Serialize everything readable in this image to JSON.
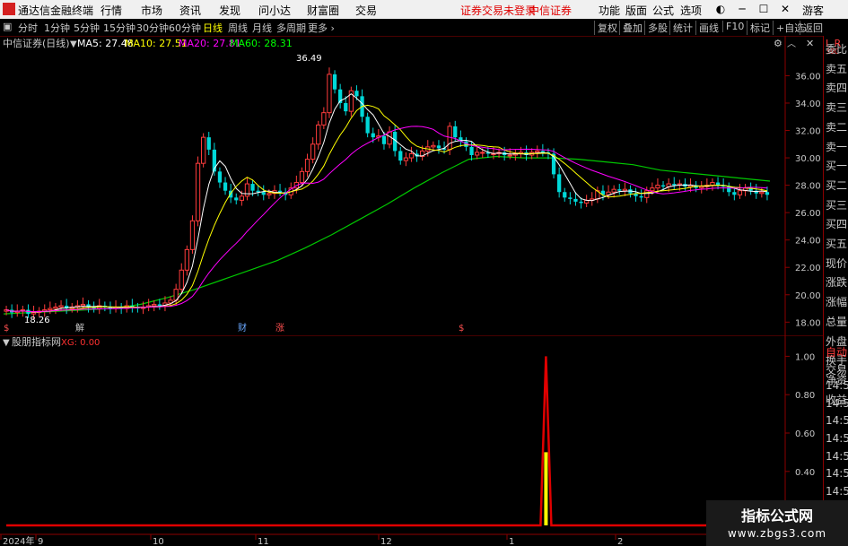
{
  "titlebar": {
    "app_name": "通达信金融终端",
    "menu": [
      "行情",
      "市场",
      "资讯",
      "发现",
      "问小达",
      "财富圈",
      "交易"
    ],
    "login_warning": "证券交易未登录",
    "broker": "中信证券",
    "right_menu": [
      "功能",
      "版面",
      "公式",
      "选项"
    ],
    "user": "游客"
  },
  "toolbar": {
    "periods": [
      "分时",
      "1分钟",
      "5分钟",
      "15分钟",
      "30分钟",
      "60分钟",
      "日线",
      "周线",
      "月线",
      "多周期",
      "更多"
    ],
    "selected_period": "日线",
    "right_buttons": [
      "复权",
      "叠加",
      "多股",
      "统计",
      "画线",
      "F10",
      "标记",
      "+自选",
      "返回"
    ]
  },
  "main_chart": {
    "stock_label": "中信证券(日线)",
    "ma_labels": [
      {
        "text": "MA5: 27.48",
        "color": "#ffffff"
      },
      {
        "text": "MA10: 27.51",
        "color": "#ffff00"
      },
      {
        "text": "MA20: 27.81",
        "color": "#ff00ff"
      },
      {
        "text": "MA60: 28.31",
        "color": "#00ff00"
      }
    ],
    "high_label": "36.49",
    "low_label": "18.26",
    "event_markers": [
      "解",
      "财",
      "涨"
    ]
  },
  "indicator": {
    "name": "股朋指标网",
    "value_label": "XG: 0.00"
  },
  "x_axis_labels": [
    "2024年",
    "9",
    "10",
    "11",
    "12",
    "1",
    "2"
  ],
  "right_panel": {
    "header_top": "L",
    "header_r": "R",
    "header_code": "300",
    "items": [
      {
        "text": "委比",
        "red": false
      },
      {
        "text": "卖五",
        "red": false
      },
      {
        "text": "卖四",
        "red": false
      },
      {
        "text": "卖三",
        "red": false
      },
      {
        "text": "卖二",
        "red": false
      },
      {
        "text": "卖一",
        "red": false
      },
      {
        "text": "买一",
        "red": false
      },
      {
        "text": "买二",
        "red": false
      },
      {
        "text": "买三",
        "red": false
      },
      {
        "text": "买四",
        "red": false
      },
      {
        "text": "买五",
        "red": false
      },
      {
        "text": "现价",
        "red": false
      },
      {
        "text": "涨跌",
        "red": false
      },
      {
        "text": "涨幅",
        "red": false
      },
      {
        "text": "总量",
        "red": false
      },
      {
        "text": "外盘",
        "red": false
      },
      {
        "text": "换手",
        "red": false
      },
      {
        "text": "净资",
        "red": false
      },
      {
        "text": "收益",
        "red": false
      },
      {
        "text": "自动",
        "red": true
      },
      {
        "text": "交易",
        "red": false
      },
      {
        "text": "14:56",
        "red": false
      },
      {
        "text": "14:56",
        "red": false
      },
      {
        "text": "14:56",
        "red": false
      },
      {
        "text": "14:56",
        "red": false
      },
      {
        "text": "14:56",
        "red": false
      },
      {
        "text": "14:56",
        "red": false
      },
      {
        "text": "14:56",
        "red": false
      }
    ]
  },
  "watermark": {
    "line1": "指标公式网",
    "line2": "www.zbgs3.com"
  },
  "chart_data": [
    {
      "type": "candlestick",
      "ylim": [
        17.3,
        37.6
      ],
      "yticks": [
        "36.00",
        "34.00",
        "32.00",
        "30.00",
        "28.00",
        "26.00",
        "24.00",
        "22.00",
        "20.00",
        "18.00"
      ],
      "series_names": [
        "MA5",
        "MA10",
        "MA20",
        "MA60"
      ],
      "annotated_high": 36.49,
      "annotated_low": 18.26,
      "closes": [
        18.9,
        18.7,
        18.8,
        18.9,
        18.6,
        18.7,
        18.8,
        18.9,
        19.0,
        19.1,
        19.2,
        19.0,
        19.1,
        19.2,
        19.3,
        19.1,
        19.0,
        19.2,
        19.1,
        19.0,
        19.1,
        19.0,
        19.2,
        19.1,
        19.0,
        19.1,
        19.2,
        19.3,
        19.2,
        19.4,
        19.6,
        20.4,
        21.8,
        23.3,
        25.4,
        29.6,
        31.5,
        30.6,
        29.0,
        28.2,
        27.6,
        27.1,
        26.9,
        27.2,
        28.1,
        27.6,
        27.5,
        27.3,
        27.4,
        27.6,
        27.5,
        27.3,
        27.8,
        28.2,
        29.0,
        29.9,
        31.0,
        32.4,
        33.3,
        36.1,
        35.0,
        34.0,
        33.4,
        34.9,
        34.5,
        33.0,
        31.8,
        31.5,
        31.6,
        31.0,
        31.9,
        30.5,
        29.8,
        30.0,
        30.3,
        30.1,
        30.5,
        30.8,
        30.9,
        30.7,
        30.6,
        32.3,
        31.5,
        31.2,
        30.8,
        30.2,
        30.4,
        30.4,
        30.3,
        30.3,
        30.4,
        30.2,
        30.2,
        30.3,
        30.4,
        30.2,
        30.4,
        30.5,
        30.4,
        30.3,
        28.8,
        27.5,
        27.1,
        27.0,
        26.8,
        26.7,
        26.9,
        27.0,
        27.6,
        27.3,
        27.5,
        27.7,
        27.6,
        27.7,
        27.4,
        27.2,
        27.1,
        27.6,
        27.8,
        28.0,
        27.9,
        28.1,
        28.0,
        28.1,
        27.9,
        28.0,
        27.8,
        27.9,
        28.0,
        28.2,
        28.0,
        27.9,
        27.5,
        27.3,
        27.6,
        27.8,
        27.6,
        27.4,
        27.5,
        27.3
      ],
      "ma60_approx": [
        18.6,
        18.7,
        18.8,
        18.9,
        19.0,
        19.3,
        19.8,
        20.4,
        21.1,
        21.8,
        22.5,
        23.4,
        24.4,
        25.5,
        26.6,
        27.8,
        28.9,
        29.9,
        30.1,
        30.0,
        30.0,
        29.9,
        29.7,
        29.5,
        29.1,
        28.9,
        28.7,
        28.5,
        28.3
      ]
    },
    {
      "type": "bar",
      "name": "XG",
      "ylim": [
        0.1,
        1.1
      ],
      "yticks": [
        "1.00",
        "0.80",
        "0.60",
        "0.40",
        "0.20"
      ],
      "values": [
        0,
        0,
        0,
        0,
        0,
        0,
        0,
        0,
        0,
        0,
        0,
        0,
        0,
        0,
        0,
        0,
        0,
        0,
        0,
        0,
        0,
        0,
        0,
        0,
        0,
        0,
        0,
        0,
        0,
        0,
        0,
        0,
        0,
        0,
        0,
        0,
        0,
        0,
        0,
        0,
        0,
        0,
        0,
        0,
        0,
        0,
        0,
        0,
        0,
        0,
        0,
        0,
        0,
        0,
        0,
        0,
        0,
        0,
        0,
        0,
        0,
        0,
        0,
        0,
        0,
        0,
        0,
        0,
        0,
        0,
        0,
        0,
        0,
        0,
        0,
        0,
        0,
        0,
        0,
        0,
        0,
        0,
        0,
        0,
        0,
        0,
        0,
        0,
        0,
        0,
        0,
        0,
        0,
        0,
        0,
        0,
        0,
        0,
        0,
        0,
        1,
        0,
        0,
        0,
        0,
        0,
        0,
        0,
        0,
        0,
        0,
        0,
        0,
        0,
        0,
        0,
        0,
        0,
        0,
        0,
        0,
        0,
        0,
        0,
        0,
        0,
        0,
        0,
        0,
        0,
        0,
        0,
        0,
        0,
        0,
        0,
        0,
        0,
        0,
        0,
        0,
        0
      ]
    }
  ]
}
